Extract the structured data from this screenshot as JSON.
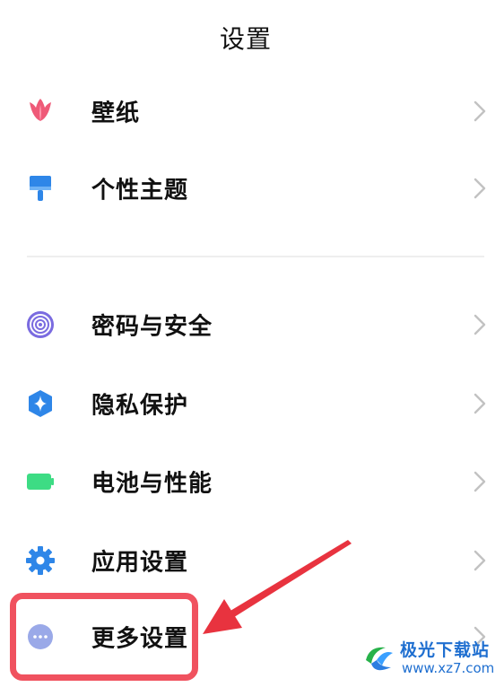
{
  "header": {
    "title": "设置"
  },
  "groups": [
    {
      "items": [
        {
          "label": "壁纸",
          "icon": "tulip-icon",
          "color": "#ef5a78"
        },
        {
          "label": "个性主题",
          "icon": "brush-icon",
          "color": "#2e86e8"
        }
      ]
    },
    {
      "items": [
        {
          "label": "密码与安全",
          "icon": "fingerprint-icon",
          "color": "#7a6be0"
        },
        {
          "label": "隐私保护",
          "icon": "shield-icon",
          "color": "#2e86e8"
        },
        {
          "label": "电池与性能",
          "icon": "battery-icon",
          "color": "#3ddc84"
        },
        {
          "label": "应用设置",
          "icon": "gear-icon",
          "color": "#2e86e8"
        },
        {
          "label": "更多设置",
          "icon": "more-dots-icon",
          "color": "#9aa9e8"
        }
      ]
    }
  ],
  "annotation": {
    "highlight_color": "#f0525f",
    "arrow_color": "#e8333f"
  },
  "watermark": {
    "title": "极光下载站",
    "url": "www.xz7.com",
    "color": "#1f6fd0"
  }
}
